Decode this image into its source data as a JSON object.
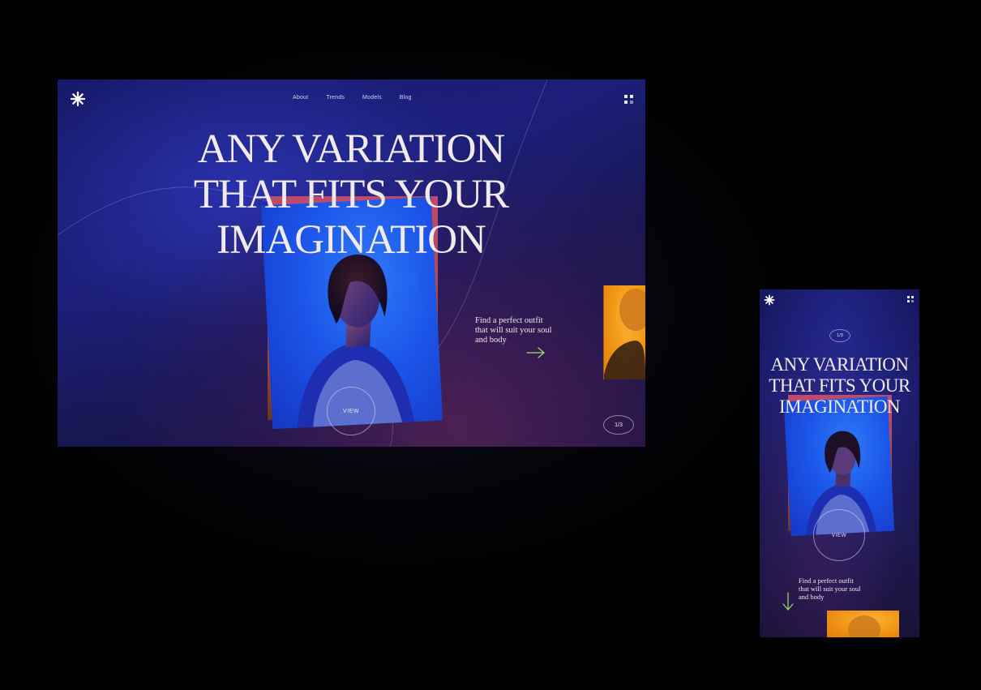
{
  "colors": {
    "accent_arrow": "#9be36b",
    "photo_blue": "#1c56ea",
    "card_red": "#b4465a",
    "peek_orange": "#f29a18"
  },
  "desktop": {
    "logo_icon": "asterisk-icon",
    "nav": [
      "About",
      "Trends",
      "Models",
      "Blog"
    ],
    "menu_icon": "grid-menu-icon",
    "headline": [
      "ANY VARIATION",
      "THAT FITS YOUR",
      "IMAGINATION"
    ],
    "view_label": "VIEW",
    "tagline": [
      "Find a perfect outfit",
      "that will suit your soul",
      "and body"
    ],
    "arrow_icon": "arrow-right-icon",
    "pager": "1/3"
  },
  "mobile": {
    "logo_icon": "asterisk-icon",
    "menu_icon": "grid-menu-icon",
    "pager": "1/3",
    "headline": [
      "ANY VARIATION",
      "THAT FITS YOUR",
      "IMAGINATION"
    ],
    "view_label": "VIEW",
    "tagline": [
      "Find a perfect outfit",
      "that will suit your soul",
      "and body"
    ],
    "arrow_icon": "arrow-down-icon"
  }
}
